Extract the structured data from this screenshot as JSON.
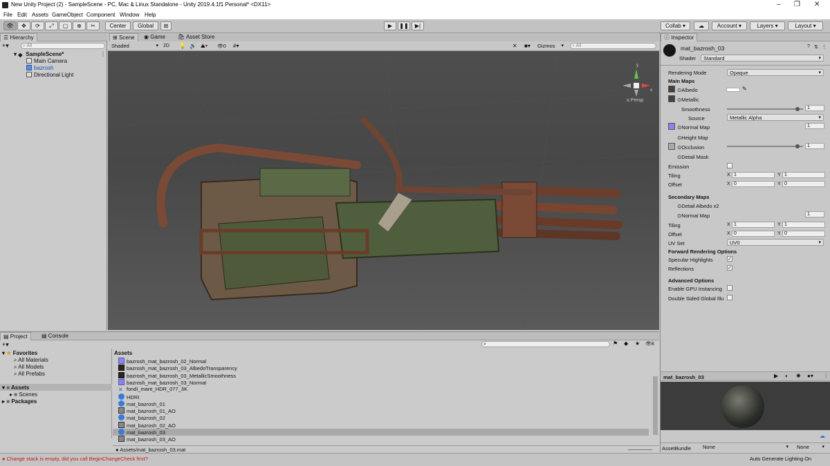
{
  "window": {
    "title": "New Unity Project (2) - SampleScene - PC, Mac & Linux Standalone - Unity 2019.4.1f1 Personal* <DX11>"
  },
  "menu": [
    "File",
    "Edit",
    "Assets",
    "GameObject",
    "Component",
    "Window",
    "Help"
  ],
  "toolbar": {
    "pivot": "Center",
    "space": "Global",
    "collab": "Collab",
    "account": "Account",
    "layers": "Layers",
    "layout": "Layout"
  },
  "hierarchy": {
    "tab": "Hierarchy",
    "search_placeholder": "All",
    "scene": "SampleScene*",
    "items": [
      "Main Camera",
      "bazrosh",
      "Directional Light"
    ]
  },
  "scene": {
    "tabs": [
      "Scene",
      "Game",
      "Asset Store"
    ],
    "shading": "Shaded",
    "mode2d": "2D",
    "fx": "0",
    "gizmos": "Gizmos",
    "search_placeholder": "All",
    "persp": "Persp",
    "gizmo_axes": {
      "y": "y",
      "x": "x"
    }
  },
  "inspector": {
    "tab": "Inspector",
    "material": "mat_bazrosh_03",
    "shader_label": "Shader",
    "shader": "Standard",
    "rendering_mode_label": "Rendering Mode",
    "rendering_mode": "Opaque",
    "main_maps": "Main Maps",
    "albedo": "Albedo",
    "metallic": "Metallic",
    "smoothness": "Smoothness",
    "smoothness_value": "1",
    "smoothness_fraction": 0.93,
    "source_label": "Source",
    "source": "Metallic Alpha",
    "normal_map": "Normal Map",
    "normal_value": "1",
    "height_map": "Height Map",
    "occlusion": "Occlusion",
    "occlusion_value": "1",
    "occlusion_fraction": 0.93,
    "detail_mask": "Detail Mask",
    "emission": "Emission",
    "tiling": "Tiling",
    "offset": "Offset",
    "x": "X",
    "y": "Y",
    "tiling_x": "1",
    "tiling_y": "1",
    "offset_x": "0",
    "offset_y": "0",
    "secondary_maps": "Secondary Maps",
    "detail_albedo": "Detail Albedo x2",
    "sec_normal_map": "Normal Map",
    "sec_normal_value": "1",
    "sec_tiling_x": "1",
    "sec_tiling_y": "1",
    "sec_offset_x": "0",
    "sec_offset_y": "0",
    "uv_set_label": "UV Set",
    "uv_set": "UV0",
    "forward_options": "Forward Rendering Options",
    "specular": "Specular Highlights",
    "reflections": "Reflections",
    "advanced": "Advanced Options",
    "gpu_instancing": "Enable GPU Instancing",
    "double_sided": "Double Sided Global Illu",
    "preview_title": "mat_bazrosh_03",
    "assetbundle_label": "AssetBundle",
    "assetbundle": "None",
    "variant": "None",
    "colors": {
      "normal": "#8a86e8",
      "albedo": "#4a4038"
    }
  },
  "project": {
    "tabs": [
      "Project",
      "Console"
    ],
    "favorites": "Favorites",
    "fav_items": [
      "All Materials",
      "All Models",
      "All Prefabs"
    ],
    "assets": "Assets",
    "asset_children": [
      "Scenes"
    ],
    "packages": "Packages",
    "breadcrumb": "Assets",
    "count": "8",
    "files": [
      {
        "name": "bazrosh_mat_bazrosh_02_Normal",
        "icon": "normal"
      },
      {
        "name": "bazrosh_mat_bazrosh_03_AlbedoTransparency",
        "icon": "dark"
      },
      {
        "name": "bazrosh_mat_bazrosh_03_MetallicSmoothness",
        "icon": "dark"
      },
      {
        "name": "bazrosh_mat_bazrosh_03_Normal",
        "icon": "normal"
      },
      {
        "name": "fondi_mare_HDR_077_3K",
        "icon": "hdr"
      },
      {
        "name": "HDRI",
        "icon": "sphere"
      },
      {
        "name": "mat_bazrosh_01",
        "icon": "sphere"
      },
      {
        "name": "mat_bazrosh_01_AO",
        "icon": "ao"
      },
      {
        "name": "mat_bazrosh_02",
        "icon": "sphere"
      },
      {
        "name": "mat_bazrosh_02_AO",
        "icon": "ao"
      },
      {
        "name": "mat_bazrosh_03",
        "icon": "sphere",
        "selected": true
      },
      {
        "name": "mat_bazrosh_03_AO",
        "icon": "ao"
      }
    ],
    "selected_path": "Assets/mat_bazrosh_03.mat"
  },
  "status": {
    "error": "Change stack is empty, did you call BeginChangeCheck first?",
    "lighting": "Auto Generate Lighting On"
  }
}
